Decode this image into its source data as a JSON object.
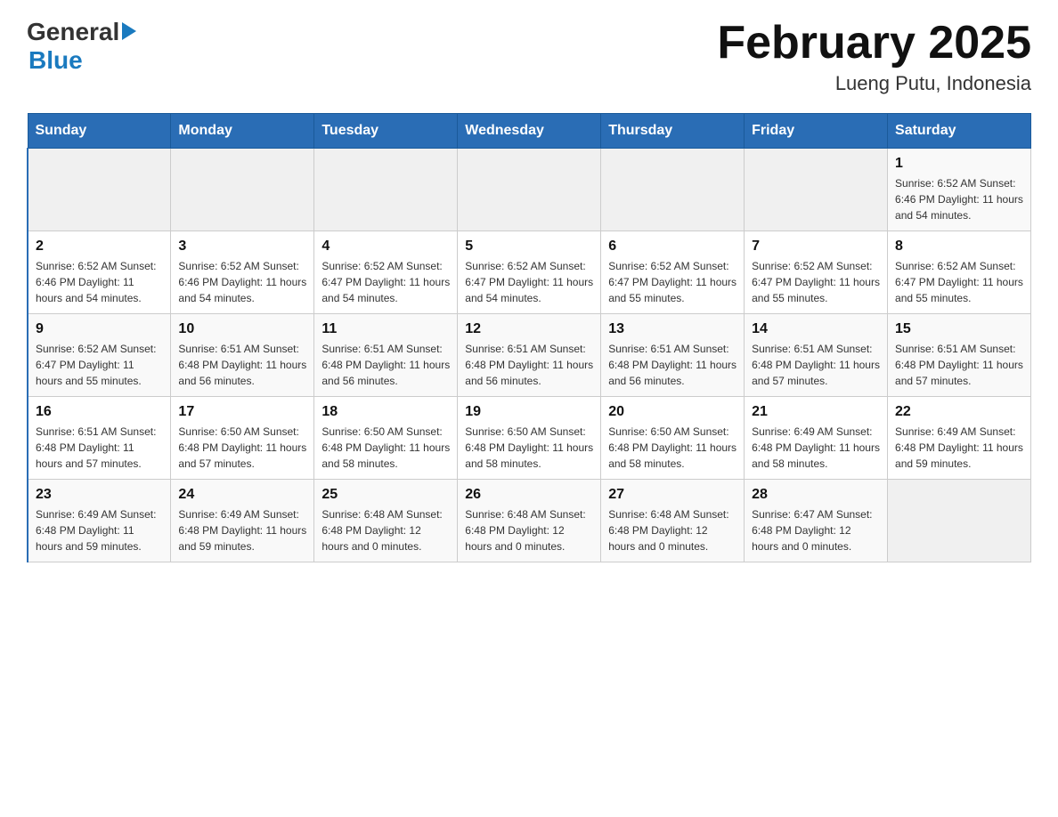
{
  "header": {
    "logo": {
      "general": "General",
      "blue": "Blue"
    },
    "title": "February 2025",
    "subtitle": "Lueng Putu, Indonesia"
  },
  "weekdays": [
    "Sunday",
    "Monday",
    "Tuesday",
    "Wednesday",
    "Thursday",
    "Friday",
    "Saturday"
  ],
  "weeks": [
    [
      {
        "day": "",
        "info": ""
      },
      {
        "day": "",
        "info": ""
      },
      {
        "day": "",
        "info": ""
      },
      {
        "day": "",
        "info": ""
      },
      {
        "day": "",
        "info": ""
      },
      {
        "day": "",
        "info": ""
      },
      {
        "day": "1",
        "info": "Sunrise: 6:52 AM\nSunset: 6:46 PM\nDaylight: 11 hours\nand 54 minutes."
      }
    ],
    [
      {
        "day": "2",
        "info": "Sunrise: 6:52 AM\nSunset: 6:46 PM\nDaylight: 11 hours\nand 54 minutes."
      },
      {
        "day": "3",
        "info": "Sunrise: 6:52 AM\nSunset: 6:46 PM\nDaylight: 11 hours\nand 54 minutes."
      },
      {
        "day": "4",
        "info": "Sunrise: 6:52 AM\nSunset: 6:47 PM\nDaylight: 11 hours\nand 54 minutes."
      },
      {
        "day": "5",
        "info": "Sunrise: 6:52 AM\nSunset: 6:47 PM\nDaylight: 11 hours\nand 54 minutes."
      },
      {
        "day": "6",
        "info": "Sunrise: 6:52 AM\nSunset: 6:47 PM\nDaylight: 11 hours\nand 55 minutes."
      },
      {
        "day": "7",
        "info": "Sunrise: 6:52 AM\nSunset: 6:47 PM\nDaylight: 11 hours\nand 55 minutes."
      },
      {
        "day": "8",
        "info": "Sunrise: 6:52 AM\nSunset: 6:47 PM\nDaylight: 11 hours\nand 55 minutes."
      }
    ],
    [
      {
        "day": "9",
        "info": "Sunrise: 6:52 AM\nSunset: 6:47 PM\nDaylight: 11 hours\nand 55 minutes."
      },
      {
        "day": "10",
        "info": "Sunrise: 6:51 AM\nSunset: 6:48 PM\nDaylight: 11 hours\nand 56 minutes."
      },
      {
        "day": "11",
        "info": "Sunrise: 6:51 AM\nSunset: 6:48 PM\nDaylight: 11 hours\nand 56 minutes."
      },
      {
        "day": "12",
        "info": "Sunrise: 6:51 AM\nSunset: 6:48 PM\nDaylight: 11 hours\nand 56 minutes."
      },
      {
        "day": "13",
        "info": "Sunrise: 6:51 AM\nSunset: 6:48 PM\nDaylight: 11 hours\nand 56 minutes."
      },
      {
        "day": "14",
        "info": "Sunrise: 6:51 AM\nSunset: 6:48 PM\nDaylight: 11 hours\nand 57 minutes."
      },
      {
        "day": "15",
        "info": "Sunrise: 6:51 AM\nSunset: 6:48 PM\nDaylight: 11 hours\nand 57 minutes."
      }
    ],
    [
      {
        "day": "16",
        "info": "Sunrise: 6:51 AM\nSunset: 6:48 PM\nDaylight: 11 hours\nand 57 minutes."
      },
      {
        "day": "17",
        "info": "Sunrise: 6:50 AM\nSunset: 6:48 PM\nDaylight: 11 hours\nand 57 minutes."
      },
      {
        "day": "18",
        "info": "Sunrise: 6:50 AM\nSunset: 6:48 PM\nDaylight: 11 hours\nand 58 minutes."
      },
      {
        "day": "19",
        "info": "Sunrise: 6:50 AM\nSunset: 6:48 PM\nDaylight: 11 hours\nand 58 minutes."
      },
      {
        "day": "20",
        "info": "Sunrise: 6:50 AM\nSunset: 6:48 PM\nDaylight: 11 hours\nand 58 minutes."
      },
      {
        "day": "21",
        "info": "Sunrise: 6:49 AM\nSunset: 6:48 PM\nDaylight: 11 hours\nand 58 minutes."
      },
      {
        "day": "22",
        "info": "Sunrise: 6:49 AM\nSunset: 6:48 PM\nDaylight: 11 hours\nand 59 minutes."
      }
    ],
    [
      {
        "day": "23",
        "info": "Sunrise: 6:49 AM\nSunset: 6:48 PM\nDaylight: 11 hours\nand 59 minutes."
      },
      {
        "day": "24",
        "info": "Sunrise: 6:49 AM\nSunset: 6:48 PM\nDaylight: 11 hours\nand 59 minutes."
      },
      {
        "day": "25",
        "info": "Sunrise: 6:48 AM\nSunset: 6:48 PM\nDaylight: 12 hours\nand 0 minutes."
      },
      {
        "day": "26",
        "info": "Sunrise: 6:48 AM\nSunset: 6:48 PM\nDaylight: 12 hours\nand 0 minutes."
      },
      {
        "day": "27",
        "info": "Sunrise: 6:48 AM\nSunset: 6:48 PM\nDaylight: 12 hours\nand 0 minutes."
      },
      {
        "day": "28",
        "info": "Sunrise: 6:47 AM\nSunset: 6:48 PM\nDaylight: 12 hours\nand 0 minutes."
      },
      {
        "day": "",
        "info": ""
      }
    ]
  ]
}
